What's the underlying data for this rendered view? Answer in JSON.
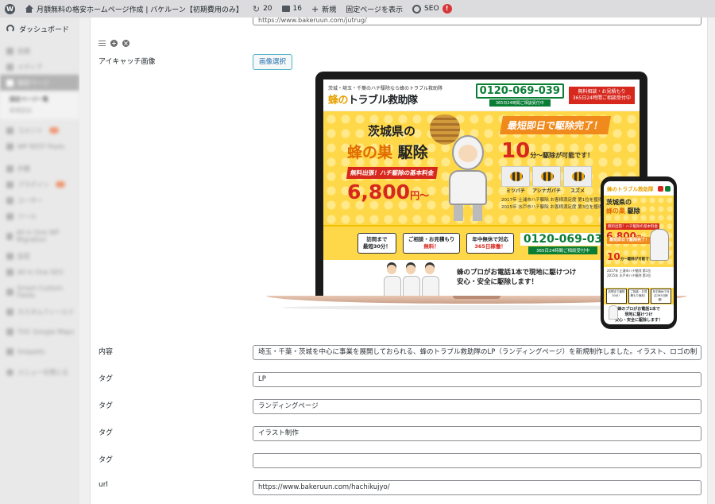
{
  "adminbar": {
    "site_title": "月額無料の格安ホームページ作成 | バケルーン【初期費用のみ】",
    "updates_count": "20",
    "comments_count": "16",
    "new_label": "新規",
    "view_page_label": "固定ページを表示",
    "seo_label": "SEO",
    "seo_badge": "!"
  },
  "sidebar": {
    "dashboard_label": "ダッシュボード",
    "wp_logo": "W",
    "blurred_items": [
      "投稿",
      "メディア",
      "固定ページ",
      "固定ページ一覧",
      "新規追加",
      "コメント",
      "WP REST Posts",
      "外観",
      "プラグイン",
      "ユーザー",
      "ツール",
      "All in One WP Migration",
      "設定",
      "All in One SEO",
      "Smart Custom Fields",
      "カスタムフィールド",
      "TOC Google Maps",
      "Snippets",
      "メニューを閉じる"
    ]
  },
  "form": {
    "top_url_value": "https://www.bakeruun.com/jutrug/",
    "eyecatch_label": "アイキャッチ画像",
    "select_image_button": "画像選択",
    "content_label": "内容",
    "content_value": "埼玉・千葉・茨城を中心に事業を展開しておられる、蜂のトラブル救助隊のLP（ランディングページ）を新規制作しました。イラスト、ロゴの制",
    "tag_label": "タグ",
    "tag1_value": "LP",
    "tag2_value": "ランディングページ",
    "tag3_value": "イラスト制作",
    "tag4_value": "",
    "url_label": "url",
    "url_value": "https://www.bakeruun.com/hachikujyo/"
  },
  "lp": {
    "header_small": "茨城・埼玉・千葉のハチ駆除なら蜂のトラブル救助隊",
    "logo_hachi": "蜂の",
    "logo_rest": "トラブル救助隊",
    "tel": "0120-069-039",
    "tel_sub": "365日24時間ご相談受付中",
    "mail_l1": "無料相談・お見積もり",
    "mail_l2": "365日24時間ご相談受付中",
    "hero_line1": "茨城県の",
    "hero_line2a": "蜂の巣",
    "hero_line2b": "駆除",
    "hero_badge": "無料出張！ハチ駆除の基本料金",
    "hero_price": "6,800",
    "hero_price_unit": "円〜",
    "ribbon": "最短即日で駆除完了！",
    "big_num": "10",
    "big_text": "分〜駆除が可能です！",
    "bee1": "ミツバチ",
    "bee2": "アシナガバチ",
    "bee3": "スズメ",
    "rank1": "2017年 土浦市ハチ駆除 お客様満足度 第1位を獲得",
    "rank2": "2015年 水戸市ハチ駆除 お客様満足度 第3位を獲得",
    "cta1_l1": "訪問まで",
    "cta1_l2": "最短30分！",
    "cta2_l1": "ご相談・お見積もり",
    "cta2_l2": "無料！",
    "cta3_l1": "年中無休で対応",
    "cta3_l2": "365日稼働！",
    "cta_tel": "0120-069-03",
    "cta_tel_sub": "365日24時間ご相談受付中",
    "pro_l1": "蜂のプロがお電話1本で現地に駆けつけ",
    "pro_l2": "安心・安全に駆除します！"
  },
  "phone": {
    "logo": "蜂のトラブル救助隊",
    "t1a": "茨城県の",
    "t1b": "蜂の巣",
    "t1c": "駆除",
    "badge": "無料出張！ハチ駆除の基本料金",
    "price": "6,800",
    "unit": "円〜",
    "ribbon": "最短即日で駆除完了！",
    "big_num": "10",
    "big_text": "分〜駆除が可能です！",
    "rank1": "2017年 土浦市ハチ駆除 第1位",
    "rank2": "2015年 水戸市ハチ駆除 第3位",
    "cta1": "訪問まで最短30分！",
    "cta2": "ご相談・お見積もり無料！",
    "cta3": "年中無休で対応365日稼働！",
    "foot1": "蜂のプロがお電話1本で",
    "foot2": "現地に駆けつけ",
    "foot3": "安心・安全に駆除します！"
  },
  "colors": {
    "accent": "#2271b1",
    "brand_yellow": "#ffd84a",
    "brand_red": "#d7281e",
    "brand_green": "#0a7d35"
  }
}
